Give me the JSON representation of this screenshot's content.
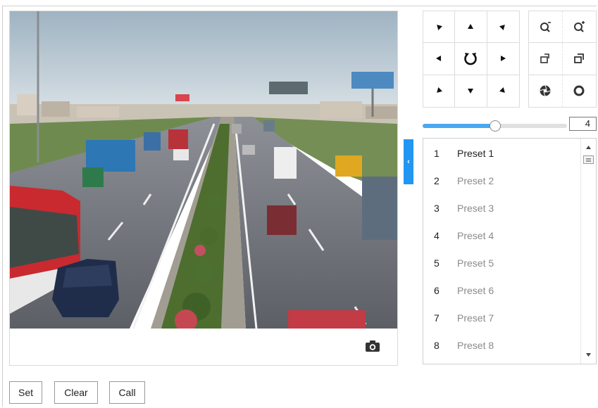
{
  "ptz": {
    "directions": [
      {
        "name": "ptz-up-left-button",
        "icon": "arrow-up-left-icon",
        "rot": -135
      },
      {
        "name": "ptz-up-button",
        "icon": "arrow-up-icon",
        "rot": -90
      },
      {
        "name": "ptz-up-right-button",
        "icon": "arrow-up-right-icon",
        "rot": -45
      },
      {
        "name": "ptz-left-button",
        "icon": "arrow-left-icon",
        "rot": 180
      },
      {
        "name": "ptz-auto-scan-button",
        "icon": "rotate-icon",
        "rot": 0
      },
      {
        "name": "ptz-right-button",
        "icon": "arrow-right-icon",
        "rot": 0
      },
      {
        "name": "ptz-down-left-button",
        "icon": "arrow-down-left-icon",
        "rot": 135
      },
      {
        "name": "ptz-down-button",
        "icon": "arrow-down-icon",
        "rot": 90
      },
      {
        "name": "ptz-down-right-button",
        "icon": "arrow-down-right-icon",
        "rot": 45
      }
    ],
    "lens_buttons": [
      {
        "name": "zoom-out-button",
        "icon": "zoom-out-icon"
      },
      {
        "name": "zoom-in-button",
        "icon": "zoom-in-icon"
      },
      {
        "name": "focus-near-button",
        "icon": "focus-near-icon"
      },
      {
        "name": "focus-far-button",
        "icon": "focus-far-icon"
      },
      {
        "name": "iris-close-button",
        "icon": "iris-close-icon"
      },
      {
        "name": "iris-open-button",
        "icon": "iris-open-icon"
      }
    ]
  },
  "speed": {
    "value": "4",
    "level": 0.5
  },
  "presets": [
    {
      "num": "1",
      "name": "Preset 1",
      "active": true
    },
    {
      "num": "2",
      "name": "Preset 2",
      "active": false
    },
    {
      "num": "3",
      "name": "Preset 3",
      "active": false
    },
    {
      "num": "4",
      "name": "Preset 4",
      "active": false
    },
    {
      "num": "5",
      "name": "Preset 5",
      "active": false
    },
    {
      "num": "6",
      "name": "Preset 6",
      "active": false
    },
    {
      "num": "7",
      "name": "Preset 7",
      "active": false
    },
    {
      "num": "8",
      "name": "Preset 8",
      "active": false
    }
  ],
  "actions": {
    "set_label": "Set",
    "clear_label": "Clear",
    "call_label": "Call"
  },
  "colors": {
    "accent": "#2196f3",
    "slider_fill": "#4aa8f0"
  }
}
